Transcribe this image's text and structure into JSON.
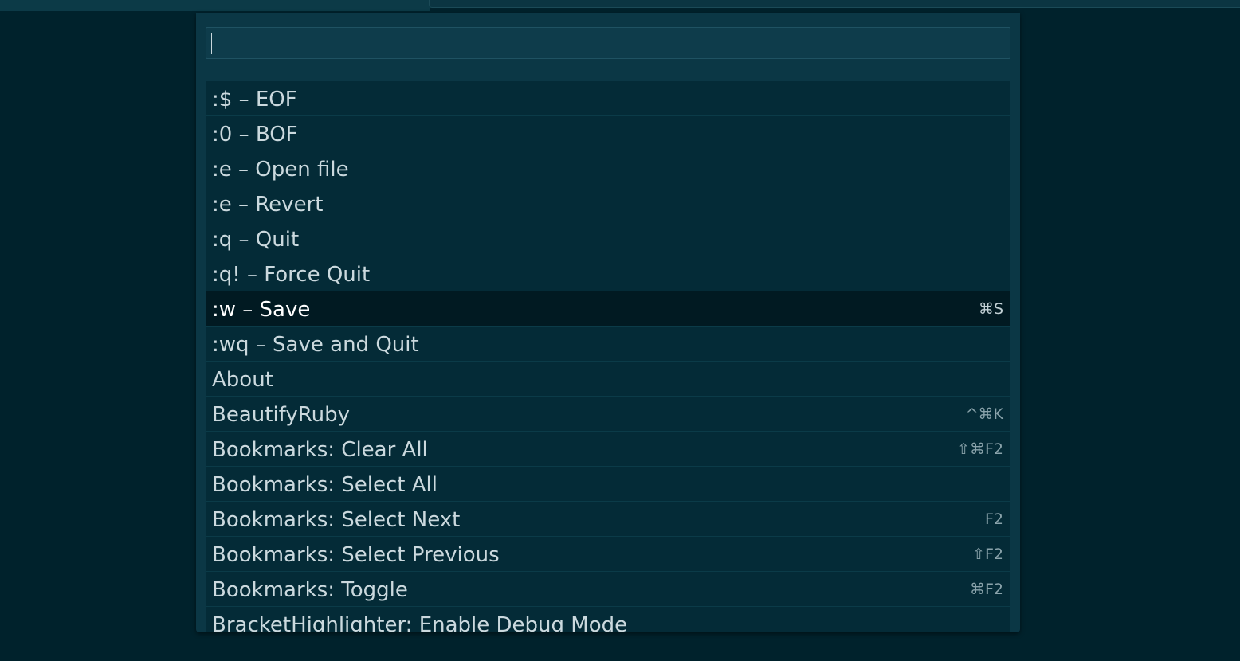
{
  "search": {
    "value": ""
  },
  "commands": [
    {
      "label": ":$ – EOF",
      "shortcut": ""
    },
    {
      "label": ":0 – BOF",
      "shortcut": ""
    },
    {
      "label": ":e – Open file",
      "shortcut": ""
    },
    {
      "label": ":e – Revert",
      "shortcut": ""
    },
    {
      "label": ":q – Quit",
      "shortcut": ""
    },
    {
      "label": ":q! – Force Quit",
      "shortcut": ""
    },
    {
      "label": ":w – Save",
      "shortcut": "⌘S",
      "selected": true
    },
    {
      "label": ":wq – Save and Quit",
      "shortcut": ""
    },
    {
      "label": "About",
      "shortcut": ""
    },
    {
      "label": "BeautifyRuby",
      "shortcut": "^⌘K"
    },
    {
      "label": "Bookmarks: Clear All",
      "shortcut": "⇧⌘F2"
    },
    {
      "label": "Bookmarks: Select All",
      "shortcut": ""
    },
    {
      "label": "Bookmarks: Select Next",
      "shortcut": "F2"
    },
    {
      "label": "Bookmarks: Select Previous",
      "shortcut": "⇧F2"
    },
    {
      "label": "Bookmarks: Toggle",
      "shortcut": "⌘F2"
    },
    {
      "label": "BracketHighlighter: Enable Debug Mode",
      "shortcut": ""
    }
  ],
  "colors": {
    "background": "#00222c",
    "panel": "#0b3745",
    "row": "#042b37",
    "selected_row": "#011a22",
    "text": "#cbd9de",
    "shortcut_text": "#8aa3ab"
  }
}
